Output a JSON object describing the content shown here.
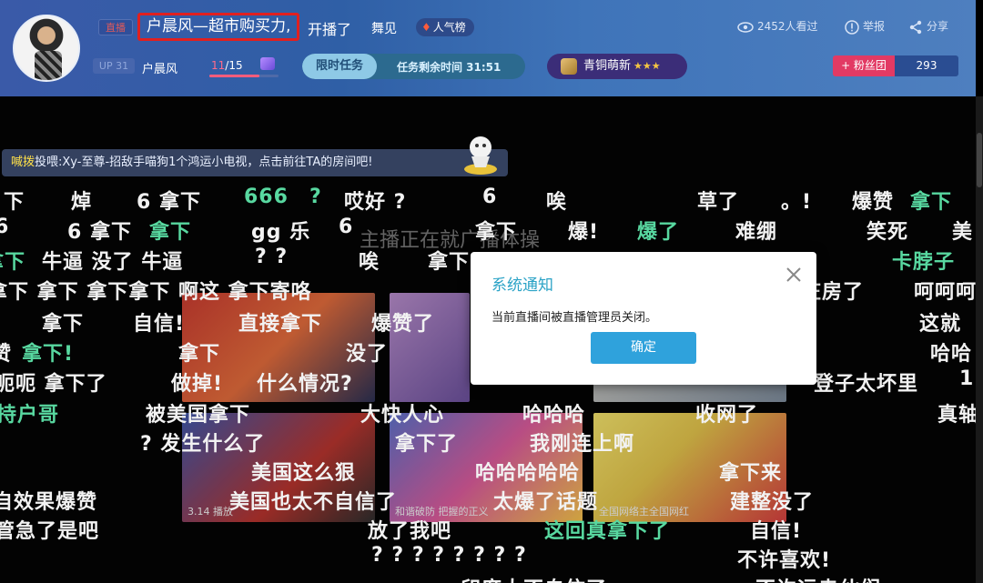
{
  "header": {
    "live_tag": "直播",
    "room_title": "户晨风—超市购买力,",
    "started_text": "开播了",
    "category": "舞见",
    "popular_badge": "人气榜",
    "level_tag": "UP 31",
    "anchor_name": "户晨风",
    "fans_progress": {
      "current": "11",
      "total": "/15",
      "fraction": 0.73
    },
    "task": {
      "label": "限时任务",
      "remaining": "任务剩余时间 31:51"
    },
    "medal": {
      "name": "青铜萌新",
      "stars": "★★★"
    },
    "viewers": "2452人看过",
    "report": "举报",
    "share": "分享",
    "fan_club": "+ 粉丝团",
    "fan_count": "293"
  },
  "ticker": {
    "highlight": "喊拨",
    "text": "投喂:Xy-至尊-招敌手喵狗1个鸿运小电视，点击前往TA的房间吧!"
  },
  "overlay_title": "主播正在就广播体操",
  "thumbnails": {
    "t1": "",
    "t2": "",
    "t3": "",
    "t4": "3.14 播放",
    "t5": "和谐破防 把握的正义",
    "t6": "全国网络主全国网红"
  },
  "danmu": [
    {
      "text": "下",
      "color": "w"
    },
    {
      "text": "焯",
      "color": "w"
    },
    {
      "text": "6 拿下",
      "color": "w"
    },
    {
      "text": "666",
      "color": "g"
    },
    {
      "text": "?",
      "color": "g"
    },
    {
      "text": "哎好 ?",
      "color": "w"
    },
    {
      "text": "6",
      "color": "w"
    },
    {
      "text": "唉",
      "color": "w"
    },
    {
      "text": "草了",
      "color": "w"
    },
    {
      "text": "。!",
      "color": "w"
    },
    {
      "text": "爆赞",
      "color": "w"
    },
    {
      "text": "拿下",
      "color": "g"
    },
    {
      "text": "6",
      "color": "w"
    },
    {
      "text": "6 拿下",
      "color": "w"
    },
    {
      "text": "拿下",
      "color": "g"
    },
    {
      "text": "gg 乐",
      "color": "w"
    },
    {
      "text": "6",
      "color": "w"
    },
    {
      "text": "拿下",
      "color": "w"
    },
    {
      "text": "爆!",
      "color": "w"
    },
    {
      "text": "爆了",
      "color": "g"
    },
    {
      "text": "难绷",
      "color": "w"
    },
    {
      "text": "笑死",
      "color": "w"
    },
    {
      "text": "美",
      "color": "w"
    },
    {
      "text": "拿下",
      "color": "g"
    },
    {
      "text": "牛逼 没了 牛逼",
      "color": "w"
    },
    {
      "text": "? ?",
      "color": "w"
    },
    {
      "text": "唉",
      "color": "w"
    },
    {
      "text": "拿下",
      "color": "w"
    },
    {
      "text": "卡脖子",
      "color": "g"
    },
    {
      "text": "拿下 拿下 拿下拿下 啊这 拿下寄咯",
      "color": "w"
    },
    {
      "text": "庄房了",
      "color": "w"
    },
    {
      "text": "呵呵呵",
      "color": "w"
    },
    {
      "text": "拿下",
      "color": "w"
    },
    {
      "text": "自信!",
      "color": "w"
    },
    {
      "text": "直接拿下",
      "color": "w"
    },
    {
      "text": "爆赞了",
      "color": "w"
    },
    {
      "text": "这就",
      "color": "w"
    },
    {
      "text": "赞",
      "color": "w"
    },
    {
      "text": "拿下!",
      "color": "g"
    },
    {
      "text": "拿下",
      "color": "w"
    },
    {
      "text": "没了",
      "color": "w"
    },
    {
      "text": "哈哈",
      "color": "w"
    },
    {
      "text": "呃呃 拿下了",
      "color": "w"
    },
    {
      "text": "做掉!",
      "color": "w"
    },
    {
      "text": "什么情况?",
      "color": "w"
    },
    {
      "text": "登子太坏里",
      "color": "w"
    },
    {
      "text": "1",
      "color": "w"
    },
    {
      "text": "持户哥",
      "color": "g"
    },
    {
      "text": "被美国拿下",
      "color": "w"
    },
    {
      "text": "大快人心",
      "color": "w"
    },
    {
      "text": "哈哈哈",
      "color": "w"
    },
    {
      "text": "收网了",
      "color": "w"
    },
    {
      "text": "真轴",
      "color": "w"
    },
    {
      "text": "? 发生什么了",
      "color": "w"
    },
    {
      "text": "拿下了",
      "color": "w"
    },
    {
      "text": "我刚连上啊",
      "color": "w"
    },
    {
      "text": "美国这么狠",
      "color": "w"
    },
    {
      "text": "哈哈哈哈哈",
      "color": "w"
    },
    {
      "text": "拿下来",
      "color": "w"
    },
    {
      "text": "自效果爆赞",
      "color": "w"
    },
    {
      "text": "美国也太不自信了",
      "color": "w"
    },
    {
      "text": "太爆了话题",
      "color": "w"
    },
    {
      "text": "建整没了",
      "color": "w"
    },
    {
      "text": "管急了是吧",
      "color": "w"
    },
    {
      "text": "放了我吧",
      "color": "w"
    },
    {
      "text": "这回真拿下了",
      "color": "g"
    },
    {
      "text": "自信!",
      "color": "w"
    },
    {
      "text": "? ? ? ? ? ? ? ?",
      "color": "w"
    },
    {
      "text": "不许喜欢!",
      "color": "w"
    },
    {
      "text": "印度太不自信了",
      "color": "w"
    },
    {
      "text": "不许运走伙们",
      "color": "w"
    }
  ],
  "modal": {
    "title": "系统通知",
    "message": "当前直播间被直播管理员关闭。",
    "ok_label": "确定"
  }
}
